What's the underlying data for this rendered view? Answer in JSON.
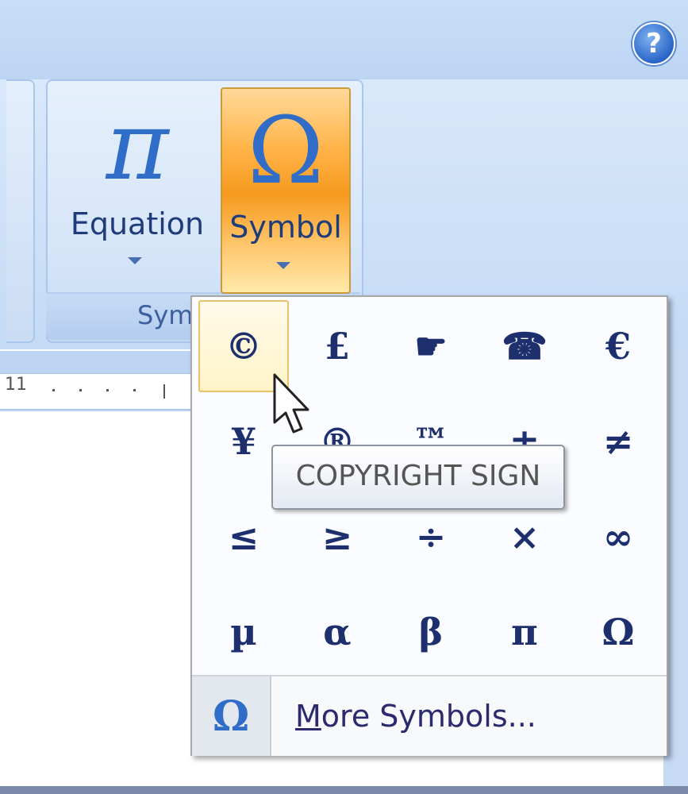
{
  "ribbon": {
    "help_icon": "?",
    "group_label": "Sym",
    "equation": {
      "glyph": "π",
      "label": "Equation"
    },
    "symbol": {
      "glyph": "Ω",
      "label": "Symbol"
    }
  },
  "ruler": {
    "number": "11"
  },
  "gallery": {
    "symbols": [
      {
        "char": "©"
      },
      {
        "char": "£"
      },
      {
        "char": "☛",
        "icon": "pointing-hand-icon"
      },
      {
        "char": "☎",
        "icon": "telephone-icon"
      },
      {
        "char": "€"
      },
      {
        "char": "¥"
      },
      {
        "char": "®"
      },
      {
        "char": "™"
      },
      {
        "char": "±"
      },
      {
        "char": "≠"
      },
      {
        "char": "≤"
      },
      {
        "char": "≥"
      },
      {
        "char": "÷"
      },
      {
        "char": "×"
      },
      {
        "char": "∞"
      },
      {
        "char": "µ"
      },
      {
        "char": "α"
      },
      {
        "char": "β"
      },
      {
        "char": "π"
      },
      {
        "char": "Ω"
      }
    ],
    "more_icon": "Ω",
    "more_label_underlined": "M",
    "more_label_rest": "ore Symbols..."
  },
  "tooltip": {
    "text": "COPYRIGHT SIGN"
  },
  "colors": {
    "accent": "#2f6dc8",
    "symbol_color": "#1e2f6e",
    "hover_border": "#e9c26e"
  }
}
